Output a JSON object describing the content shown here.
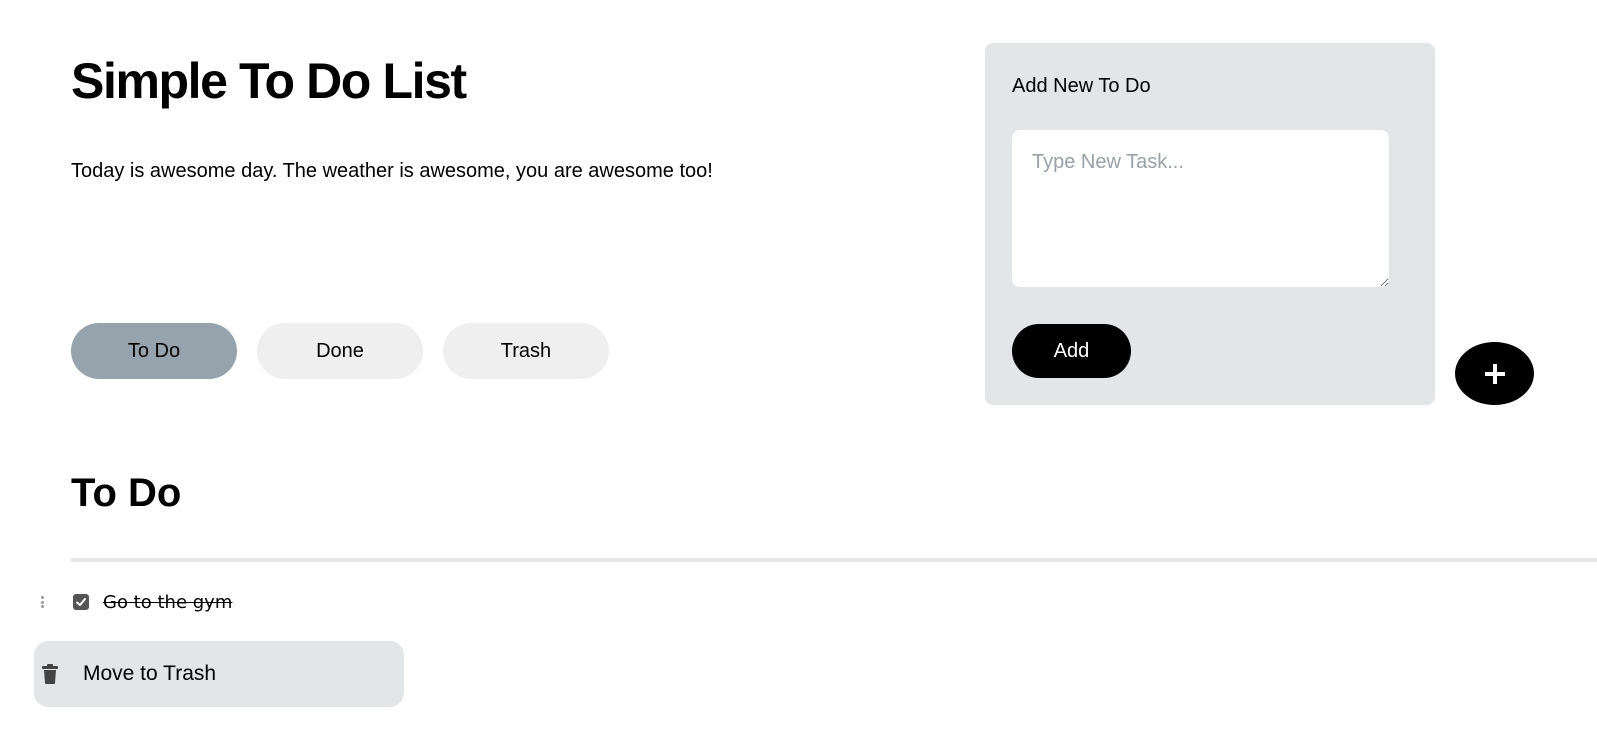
{
  "header": {
    "title": "Simple To Do List",
    "subtitle": "Today is awesome day. The weather is awesome, you are awesome too!"
  },
  "tabs": [
    {
      "label": "To Do",
      "active": true
    },
    {
      "label": "Done",
      "active": false
    },
    {
      "label": "Trash",
      "active": false
    }
  ],
  "add_panel": {
    "title": "Add New To Do",
    "placeholder": "Type New Task...",
    "value": "",
    "button_label": "Add"
  },
  "fab": {
    "label": "+",
    "icon": "plus-icon"
  },
  "section": {
    "heading": "To Do"
  },
  "todos": [
    {
      "text": "Go to the gym",
      "checked": true
    }
  ],
  "context_menu": {
    "label": "Move to Trash",
    "icon": "trash-icon"
  },
  "colors": {
    "active_tab": "#97a3ac",
    "inactive_tab": "#efefef",
    "panel_bg": "#e4e5e7",
    "button_bg": "#000000",
    "button_text": "#ffffff"
  }
}
